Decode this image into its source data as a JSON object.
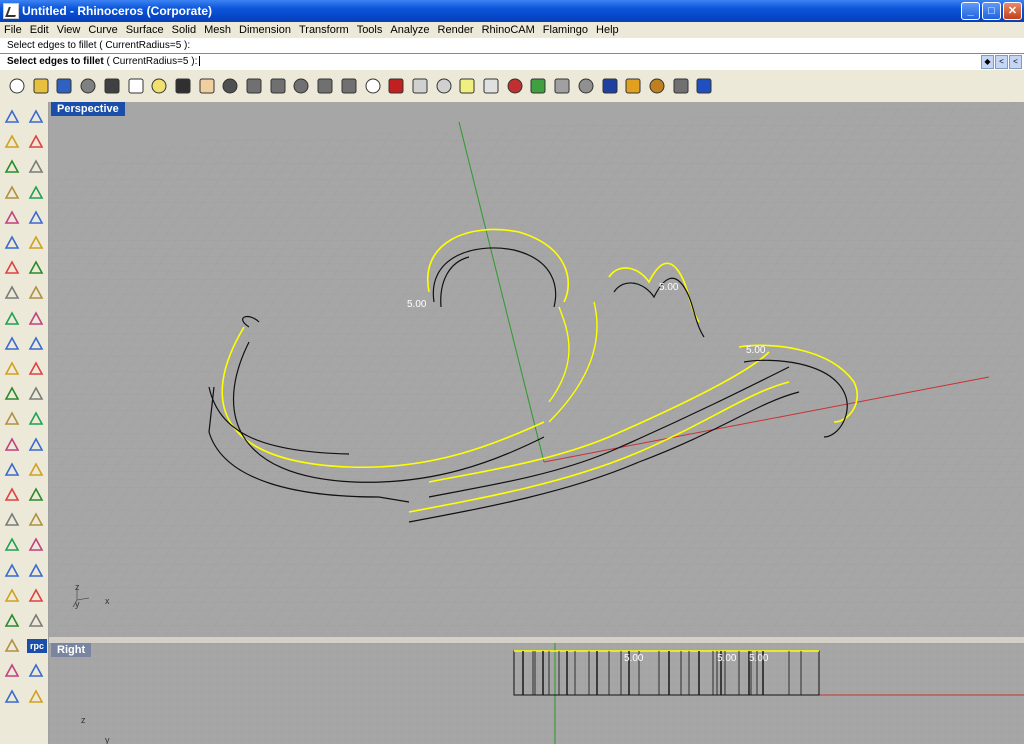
{
  "window": {
    "title": "Untitled - Rhinoceros (Corporate)",
    "buttons": {
      "minimize": "_",
      "maximize": "□",
      "close": "✕"
    }
  },
  "menu": [
    "File",
    "Edit",
    "View",
    "Curve",
    "Surface",
    "Solid",
    "Mesh",
    "Dimension",
    "Transform",
    "Tools",
    "Analyze",
    "Render",
    "RhinoCAM",
    "Flamingo",
    "Help"
  ],
  "command": {
    "history": "Select edges to fillet ( CurrentRadius=5 ):",
    "prompt_bold": "Select edges to fillet",
    "prompt_rest": " ( CurrentRadius=5 ):",
    "scroll": [
      "◆",
      "<",
      "<"
    ]
  },
  "viewports": {
    "perspective": {
      "label": "Perspective",
      "dims": [
        "5.00",
        "5.00",
        "5.00"
      ],
      "axes": {
        "z": "z",
        "y": "y",
        "x": "x"
      }
    },
    "right": {
      "label": "Right",
      "dims": [
        "5.00",
        "5.00",
        "5.00"
      ],
      "axes": {
        "z": "z",
        "y": "y"
      }
    }
  },
  "toolbar_icons": [
    "new-icon",
    "open-icon",
    "save-icon",
    "print-icon",
    "cut-icon",
    "copy-icon",
    "paste-icon",
    "undo-icon",
    "pan-hand-icon",
    "rotate-view-icon",
    "zoom-icon",
    "zoom-window-icon",
    "zoom-extents-icon",
    "zoom-selected-icon",
    "zoom-previous-icon",
    "four-viewports-icon",
    "car-icon",
    "layer-icon",
    "snap-icon",
    "lightbulb-icon",
    "lock-icon",
    "material-icon",
    "color-wheel-icon",
    "render-sphere-icon",
    "wireframe-sphere-icon",
    "shaded-sphere-icon",
    "flag-icon",
    "settings-icon",
    "network-icon",
    "help-icon"
  ],
  "rpc_label": "rpc",
  "colors": {
    "viewport": "#a6a6a6",
    "grid": "#9a9a9a",
    "selection": "#ffff00",
    "x_axis": "#c83232",
    "y_axis": "#32a032",
    "viewport_label": "#1a4ea8"
  }
}
